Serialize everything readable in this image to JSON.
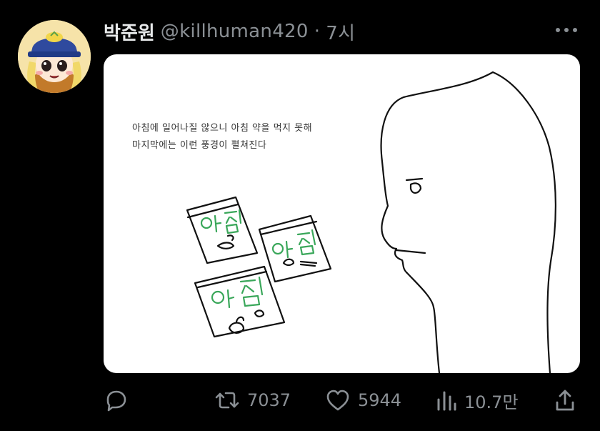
{
  "tweet": {
    "display_name": "박준원",
    "handle": "@killhuman420",
    "separator": "·",
    "time": "7시",
    "image": {
      "caption_lines": [
        "아침에 일어나질 않으니 아침 약을 먹지 못해",
        "마지막에는 이런 풍경이 펼쳐진다"
      ],
      "packet_labels": [
        "아침",
        "아침",
        "아침"
      ]
    },
    "actions": {
      "reply_count": "",
      "retweet_count": "7037",
      "like_count": "5944",
      "view_count": "10.7만"
    }
  },
  "colors": {
    "background": "#000000",
    "text_primary": "#e7e9ea",
    "text_secondary": "#8b9095",
    "drawing_green": "#3aa75a"
  },
  "icons": [
    "avatar",
    "more-icon",
    "reply-icon",
    "retweet-icon",
    "like-icon",
    "views-icon",
    "share-icon"
  ]
}
